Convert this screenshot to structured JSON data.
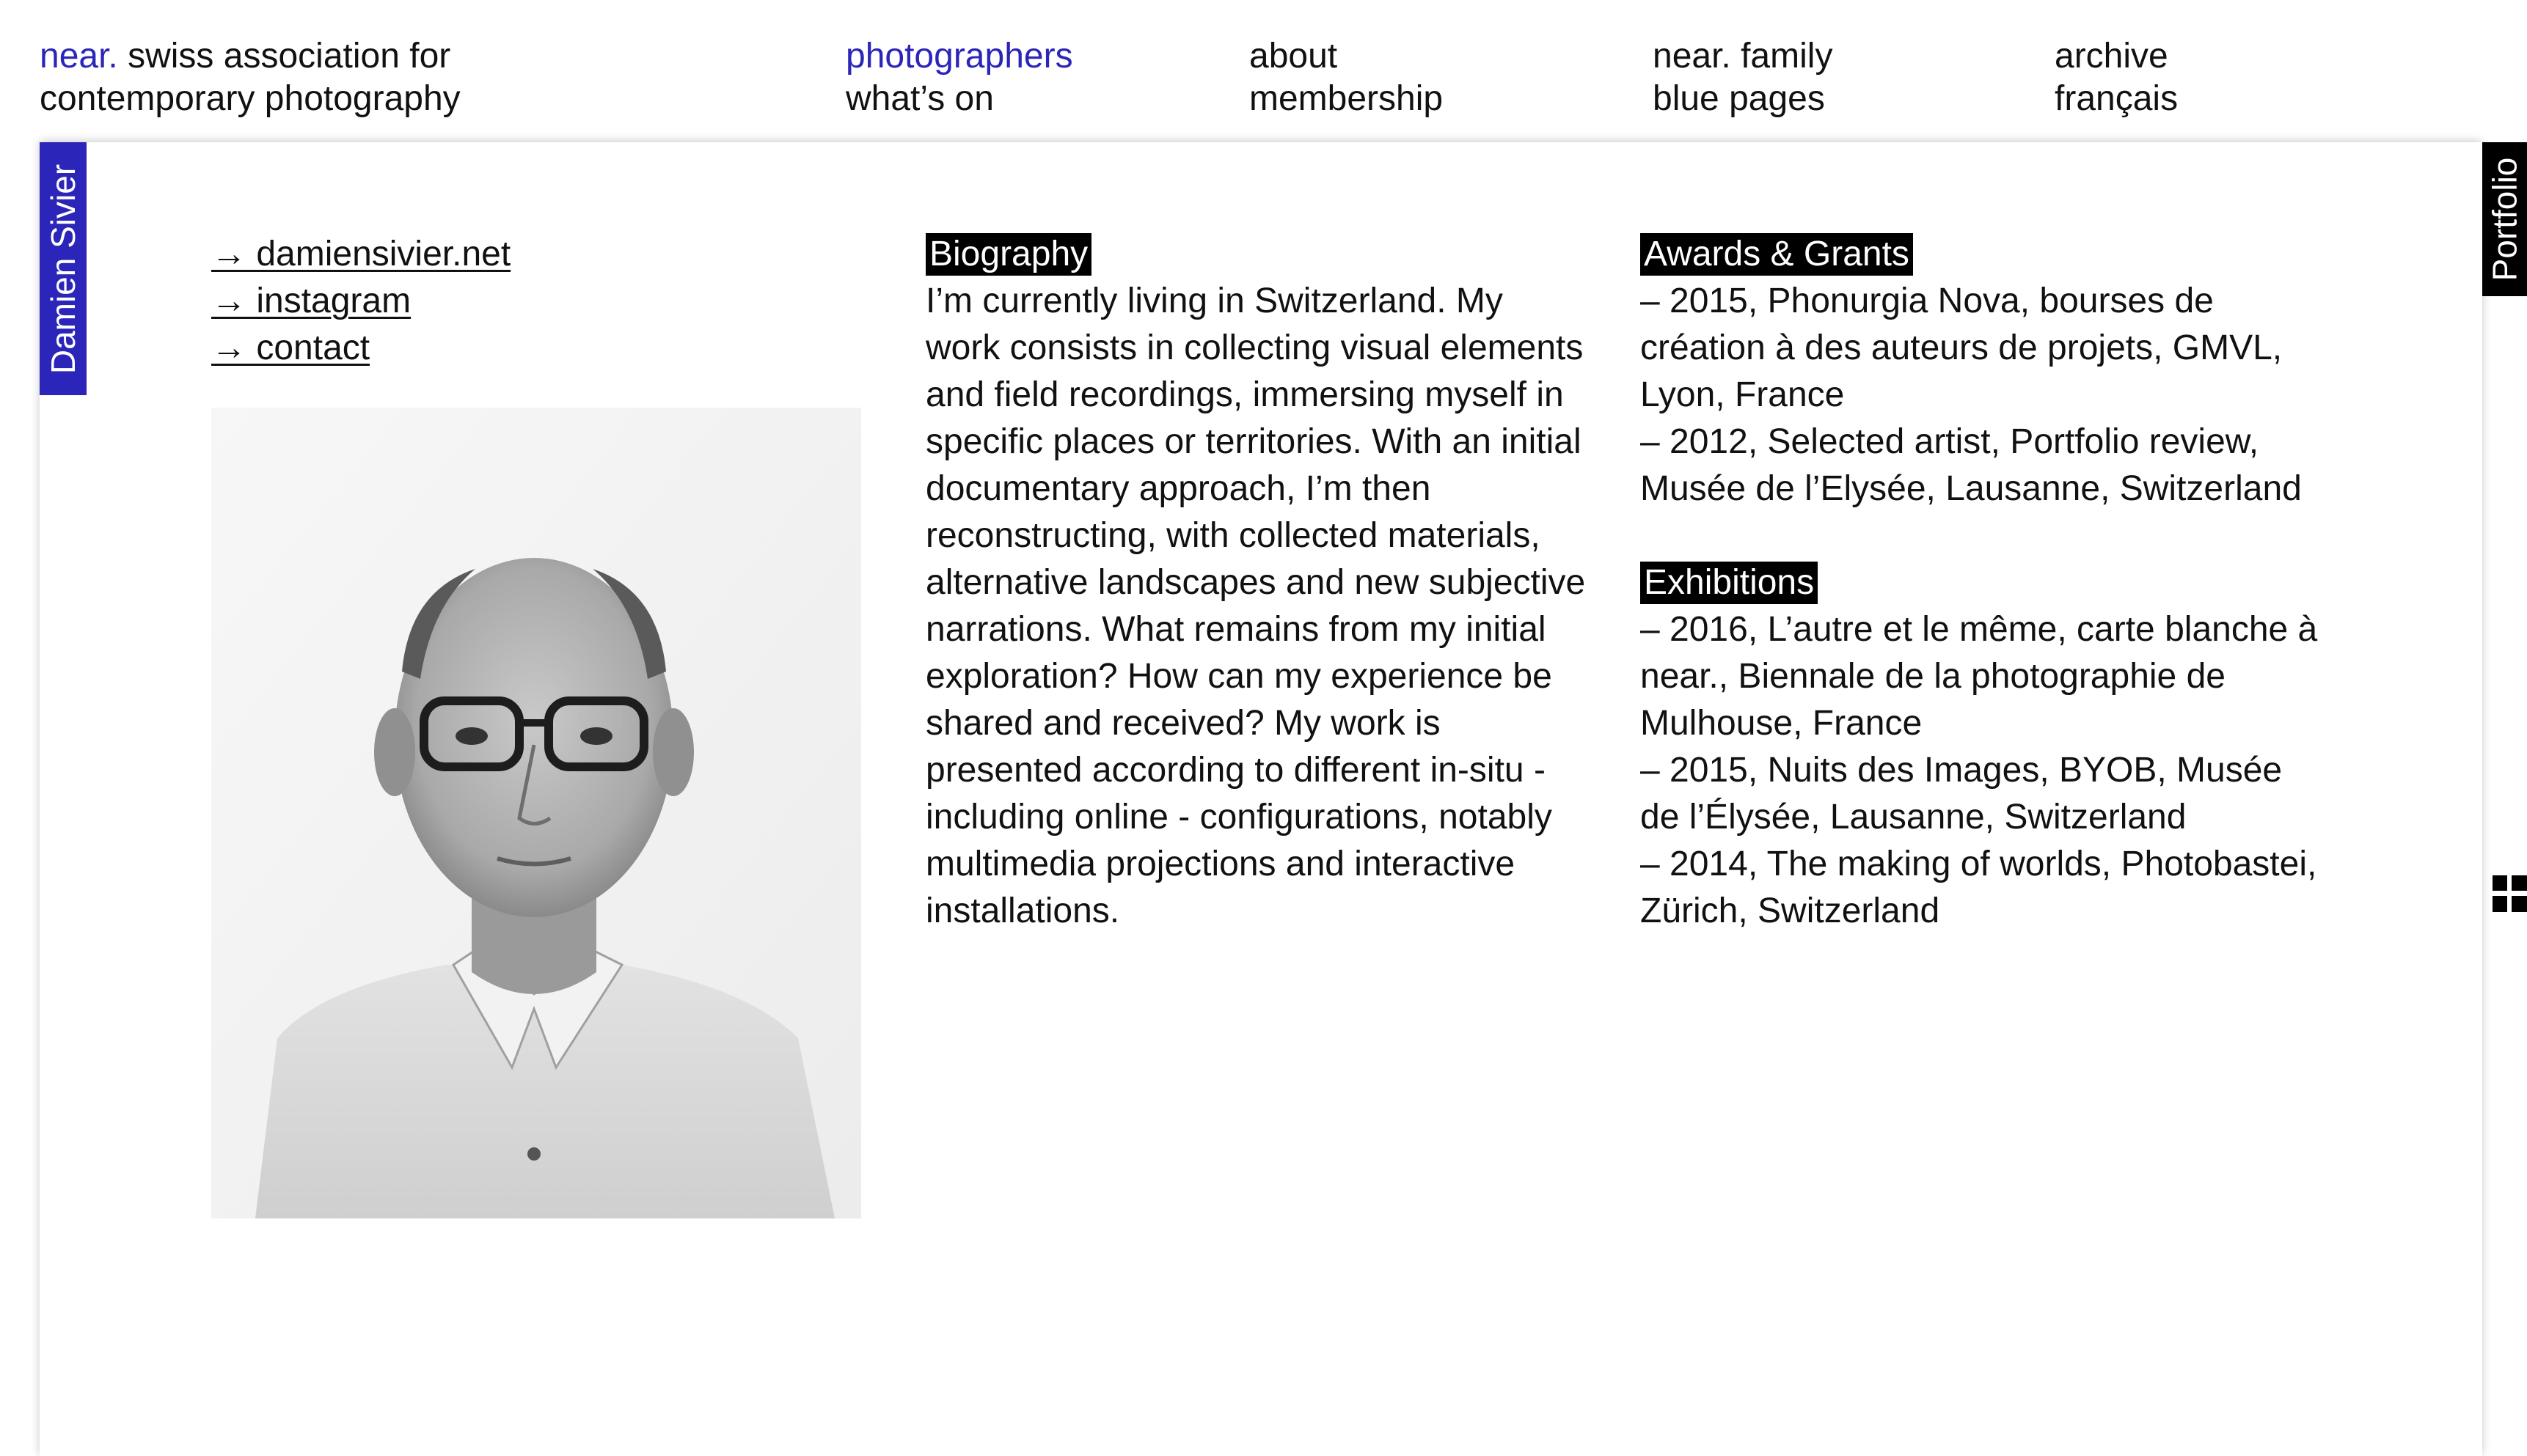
{
  "header": {
    "brand_accent": "near.",
    "brand_line1_rest": " swiss association for",
    "brand_line2": "contemporary photography",
    "nav": [
      [
        "photographers",
        "what’s on"
      ],
      [
        "about",
        "membership"
      ],
      [
        "near. family",
        "blue pages"
      ],
      [
        "archive",
        "français"
      ]
    ]
  },
  "side_tabs": {
    "left": "Damien Sivier",
    "right": "Portfolio",
    "grid_icon": "grid-icon"
  },
  "links": {
    "website": "→ damiensivier.net",
    "instagram": "→ instagram",
    "contact": "→ contact"
  },
  "portrait": {
    "description_icon": "portrait-photo"
  },
  "biography": {
    "label": "Biography",
    "text": "I’m currently living in Switzerland. My work consists in collecting visual elements and field recordings, immersing myself in specific places or territories. With an initial documentary approach, I’m then reconstructing, with collected materials, alternative landscapes and new subjective narrations. What remains from my initial exploration? How can my experience be shared and received? My work is presented according to different in-situ - including online - configurations, notably multimedia projections and interactive installations."
  },
  "awards": {
    "label": "Awards & Grants",
    "items": [
      "– 2015, Phonurgia Nova, bourses de création à des auteurs de projets, GMVL, Lyon, France",
      "– 2012, Selected artist, Portfolio review, Musée de l’Elysée, Lausanne, Switzerland"
    ]
  },
  "exhibitions": {
    "label": "Exhibitions",
    "items": [
      "– 2016, L’autre et le même, carte blanche à near., Biennale de la photographie de Mulhouse, France",
      "– 2015, Nuits des Images, BYOB, Musée de l’Élysée, Lausanne, Switzerland",
      "– 2014, The making of worlds, Photobastei, Zürich, Switzerland"
    ]
  },
  "colors": {
    "accent": "#2b25b9",
    "label_bg": "#000000",
    "text": "#111111"
  }
}
